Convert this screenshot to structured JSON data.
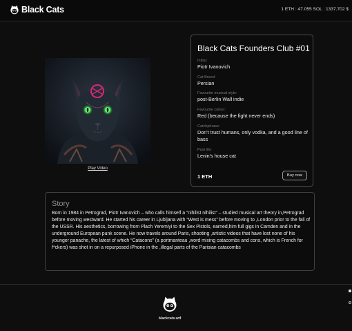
{
  "header": {
    "logo_text": "Black Cats",
    "rates": "1 ETH : 47.055 SOL : 1337.702 $"
  },
  "media": {
    "play_video_label": "Play Video"
  },
  "card": {
    "title": "Black Cats Founders Club #01",
    "attributes": [
      {
        "key": "Initial:",
        "value": "Piotr Ivanovich"
      },
      {
        "key": "Cat Breed:",
        "value": "Persian"
      },
      {
        "key": "Favourite musical style:",
        "value": "post-Berlin Wall indie"
      },
      {
        "key": "Favourite colour:",
        "value": "Red (because the fight never ends)"
      },
      {
        "key": "Catchphrase:",
        "value": "Don’t trust humans, only vodka, and a good line of bass"
      },
      {
        "key": "Past life:",
        "value": "Lenin’s house cat"
      }
    ],
    "price": "1 ETH",
    "buy_label": "Buy now"
  },
  "story": {
    "title": "Story",
    "text": "Born in 1984 in Petrograd, Piotr Ivanovich – who calls himself a “nihilist nihilist” – studied musical art theory in,Petrograd before moving westward. He started his career in Ljubljana with “West is mess” before moving to ,London prior to the fall of the USSR. His aesthetics, borrowing from Plach Yeremiyi to the Sex Pistols, earned,him full gigs in Camden and in the underground European punk scene. He now travels around Paris, shooting ,artistic videos that have lost none of his younger panache, the latest of which “Catacons” (a portmanteau ,word mixing catacombs and cons, which is French for f*ckers) was shot in on a repurposed iPhone in the ,illegal parts of the Parisian catacombs"
  },
  "footer": {
    "text": "blackcats.wtf"
  },
  "colors": {
    "background": "#0e0e0e",
    "card_border": "#4a4a4a",
    "text": "#ffffff",
    "muted": "#7a7a7a"
  }
}
